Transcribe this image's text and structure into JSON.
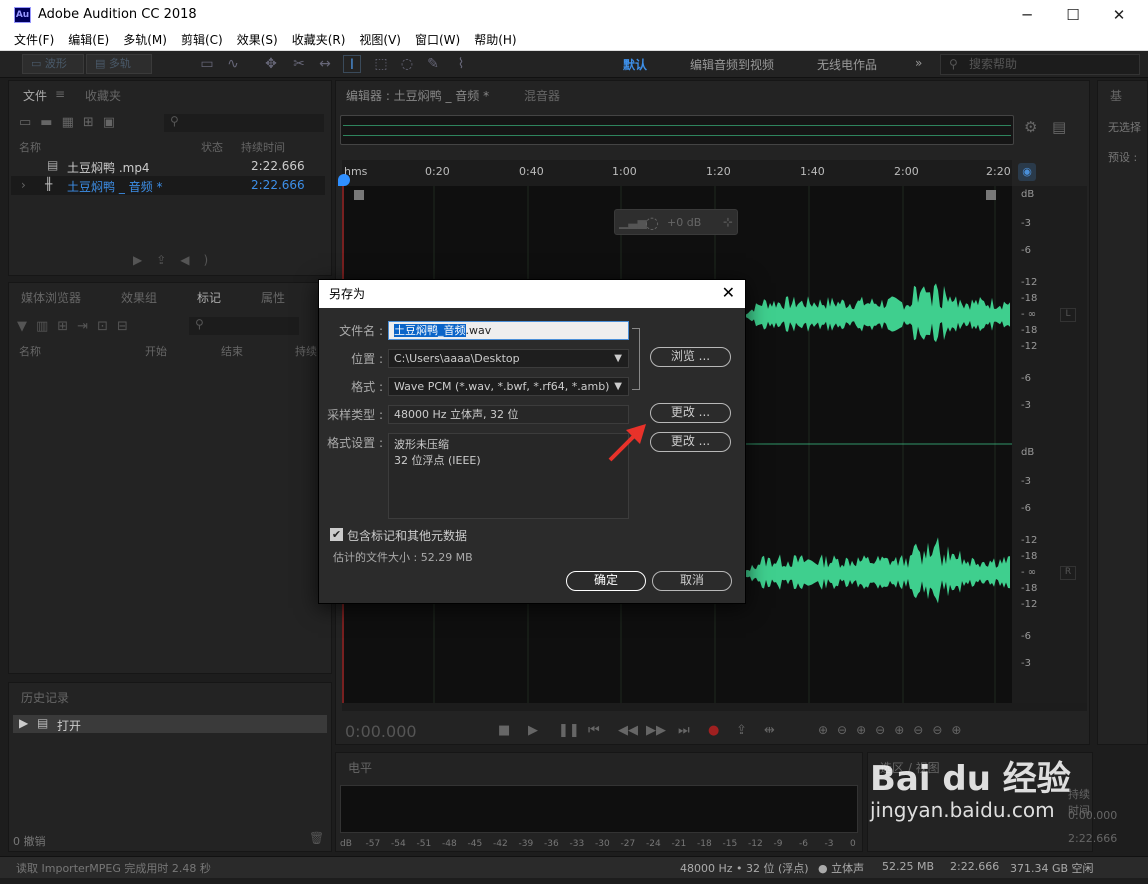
{
  "window": {
    "title": "Adobe Audition CC 2018",
    "icon_text": "Au",
    "minimize": "─",
    "maximize": "☐",
    "close": "✕"
  },
  "menu": [
    "文件(F)",
    "编辑(E)",
    "多轨(M)",
    "剪辑(C)",
    "效果(S)",
    "收藏夹(R)",
    "视图(V)",
    "窗口(W)",
    "帮助(H)"
  ],
  "toolbar": {
    "waveform": "波形",
    "multitrack": "多轨",
    "workspaces": [
      "默认",
      "编辑音频到视频",
      "无线电作品"
    ],
    "more": "»",
    "search_placeholder": "搜索帮助"
  },
  "files_panel": {
    "tabs": [
      "文件",
      "收藏夹"
    ],
    "columns": [
      "名称",
      "状态",
      "持续时间"
    ],
    "rows": [
      {
        "name": "土豆焖鸭 .mp4",
        "duration": "2:22.666"
      },
      {
        "name": "土豆焖鸭 _ 音频 *",
        "duration": "2:22.666"
      }
    ]
  },
  "media_panel": {
    "tabs": [
      "媒体浏览器",
      "效果组",
      "标记",
      "属性"
    ],
    "columns": [
      "名称",
      "开始",
      "结束",
      "持续"
    ]
  },
  "history_panel": {
    "title": "历史记录",
    "item": "打开",
    "undo_count": "0 撤销"
  },
  "editor": {
    "tab": "编辑器 : 土豆焖鸭 _ 音频 *",
    "mixer_tab": "混音器",
    "gain_label": "+0 dB",
    "time_display": "0:00.000"
  },
  "timeline_ticks": [
    "hms",
    "0:20",
    "0:40",
    "1:00",
    "1:20",
    "1:40",
    "2:00",
    "2:20"
  ],
  "db_scale": [
    "dB",
    "-3",
    "-6",
    "-12",
    "-18",
    "- ∞",
    "-18",
    "-12",
    "-6",
    "-3"
  ],
  "channels": {
    "left": "L",
    "right": "R"
  },
  "right_panel": {
    "title": "基",
    "line1": "无选择",
    "line2": "预设 :"
  },
  "levels": {
    "title": "电平",
    "ticks": [
      "dB",
      "-57",
      "-54",
      "-51",
      "-48",
      "-45",
      "-42",
      "-39",
      "-36",
      "-33",
      "-30",
      "-27",
      "-24",
      "-21",
      "-18",
      "-15",
      "-12",
      "-9",
      "-6",
      "-3",
      "0"
    ]
  },
  "selection_panel": {
    "title": "选区 / 视图",
    "duration_header": "持续时间",
    "vals": [
      "0:00.000",
      "2:22.666"
    ]
  },
  "status": {
    "left": "读取 ImporterMPEG 完成用时 2.48 秒",
    "format": "48000 Hz • 32 位 (浮点)",
    "channels": "● 立体声",
    "size": "52.25 MB",
    "duration": "2:22.666",
    "free": "371.34 GB 空闲"
  },
  "dialog": {
    "title": "另存为",
    "close": "✕",
    "filename_label": "文件名 :",
    "filename_selected": "土豆焖鸭_音频",
    "filename_ext": ".wav",
    "location_label": "位置 :",
    "location": "C:\\Users\\aaaa\\Desktop",
    "browse": "浏览 ...",
    "format_label": "格式 :",
    "format": "Wave PCM (*.wav, *.bwf, *.rf64, *.amb)",
    "sample_label": "采样类型 :",
    "sample": "48000 Hz 立体声, 32 位",
    "change": "更改 ...",
    "settings_label": "格式设置 :",
    "settings_line1": "波形未压缩",
    "settings_line2": "32 位浮点 (IEEE)",
    "include_meta": "包含标记和其他元数据",
    "est_size": "估计的文件大小 : 52.29 MB",
    "ok": "确定",
    "cancel": "取消"
  },
  "watermark": {
    "brand": "Bai du 经验",
    "url": "jingyan.baidu.com"
  },
  "colors": {
    "waveform": "#3fcf8e",
    "accent": "#2f8fff",
    "playhead": "#2f8fff",
    "arrow": "#e8322a"
  }
}
